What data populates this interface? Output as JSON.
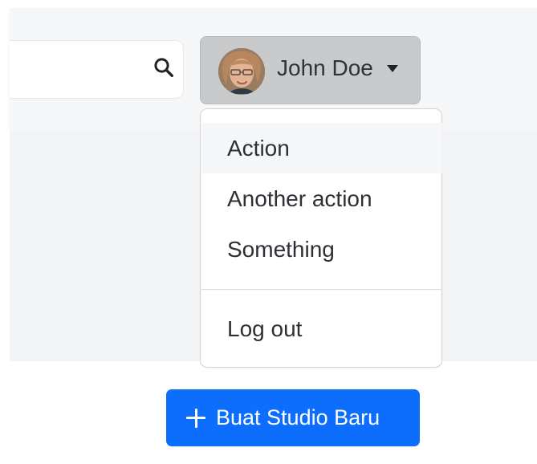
{
  "header": {
    "search": {
      "value": "",
      "placeholder": ""
    },
    "user": {
      "name": "John Doe",
      "avatar": "user-avatar"
    }
  },
  "dropdown": {
    "items": [
      {
        "label": "Action",
        "state": "hover"
      },
      {
        "label": "Another action",
        "state": "default"
      },
      {
        "label": "Something",
        "state": "default"
      }
    ],
    "logout_label": "Log out"
  },
  "actions": {
    "create_label": "Buat Studio Baru",
    "create_icon": "plus-icon"
  },
  "colors": {
    "header_bg": "#f6f7f9",
    "user_button_bg": "#c9cacc",
    "primary": "#0d6efd",
    "menu_hover": "#f6f7f9"
  }
}
